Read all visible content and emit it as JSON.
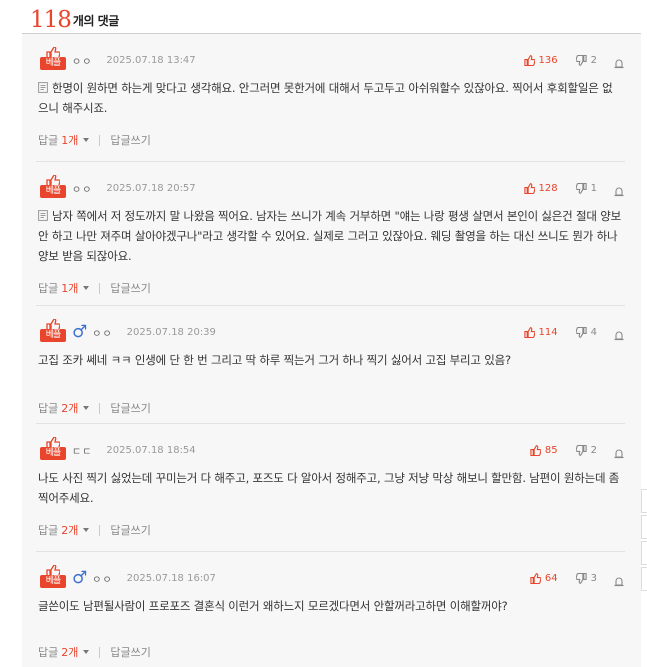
{
  "header": {
    "count": "118",
    "count_label": "개의 댓글"
  },
  "best_label": "베플",
  "comments": [
    {
      "author": "ㅇㅇ",
      "gender": "",
      "date": "2025.07.18 13:47",
      "upvotes": "136",
      "downvotes": "2",
      "has_doc_icon": true,
      "text": "한명이 원하면 하는게 맞다고 생각해요. 안그러면 못한거에 대해서 두고두고 아쉬워할수 있잖아요. 찍어서 후회할일은 없으니 해주시죠.",
      "reply_label": "답글",
      "reply_count": "1개",
      "write_reply": "답글쓰기"
    },
    {
      "author": "ㅇㅇ",
      "gender": "",
      "date": "2025.07.18 20:57",
      "upvotes": "128",
      "downvotes": "1",
      "has_doc_icon": true,
      "text": "남자 쪽에서 저 정도까지 말 나왔음 찍어요. 남자는 쓰니가 계속 거부하면 \"얘는 나랑 평생 살면서 본인이 싫은건 절대 양보 안 하고 나만 져주며 살아야겠구나\"라고 생각할 수 있어요. 실제로 그러고 있잖아요. 웨딩 촬영을 하는 대신 쓰니도 뭔가 하나 양보 받음 되잖아요.",
      "reply_label": "답글",
      "reply_count": "1개",
      "write_reply": "답글쓰기"
    },
    {
      "author": "ㅇㅇ",
      "gender": "♂",
      "date": "2025.07.18 20:39",
      "upvotes": "114",
      "downvotes": "4",
      "has_doc_icon": false,
      "text": "고집 조카 쎄네 ㅋㅋ 인생에 단 한 번 그리고 딱 하루 찍는거 그거 하나 찍기 싫어서 고집 부리고 있음?",
      "reply_label": "답글",
      "reply_count": "2개",
      "write_reply": "답글쓰기"
    },
    {
      "author": "ㄷㄷ",
      "gender": "",
      "date": "2025.07.18 18:54",
      "upvotes": "85",
      "downvotes": "2",
      "has_doc_icon": false,
      "text": "나도 사진 찍기 싫었는데 꾸미는거 다 해주고, 포즈도 다 알아서 정해주고, 그냥 저냥 막상 해보니 할만함. 남편이 원하는데 좀 찍어주세요.",
      "reply_label": "답글",
      "reply_count": "2개",
      "write_reply": "답글쓰기"
    },
    {
      "author": "ㅇㅇ",
      "gender": "♂",
      "date": "2025.07.18 16:07",
      "upvotes": "64",
      "downvotes": "3",
      "has_doc_icon": false,
      "text": "글쓴이도 남편될사람이 프로포즈 결혼식 이런거 왜하느지 모르겠다면서 안할꺼라고하면 이해할꺼야?",
      "reply_label": "답글",
      "reply_count": "2개",
      "write_reply": "답글쓰기"
    }
  ],
  "colors": {
    "accent": "#e8452c",
    "male": "#3d6fd1",
    "background": "#f7f7f7"
  },
  "icons": {
    "best": "thumbs-up-icon",
    "up": "thumbs-up-icon",
    "down": "thumbs-down-icon",
    "report": "siren-icon",
    "doc": "document-icon",
    "male": "male-icon"
  }
}
